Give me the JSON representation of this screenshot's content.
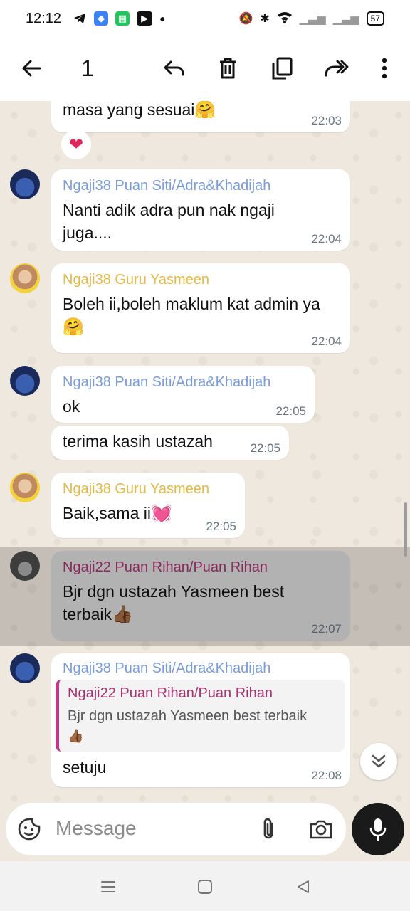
{
  "status_bar": {
    "time": "12:12",
    "battery": "57"
  },
  "action_bar": {
    "selected_count": "1"
  },
  "messages": [
    {
      "text": "masa yang sesuai",
      "emoji": "🤗",
      "time": "22:03"
    },
    {
      "sender": "Ngaji38 Puan Siti/Adra&Khadijah",
      "text": "Nanti adik adra pun nak ngaji juga....",
      "time": "22:04"
    },
    {
      "sender": "Ngaji38 Guru Yasmeen",
      "text": "Boleh ii,boleh maklum kat admin ya",
      "emoji": "🤗",
      "time": "22:04"
    },
    {
      "sender": "Ngaji38 Puan Siti/Adra&Khadijah",
      "text": "ok",
      "time": "22:05"
    },
    {
      "text": "terima kasih ustazah",
      "time": "22:05"
    },
    {
      "sender": "Ngaji38 Guru Yasmeen",
      "text": "Baik,sama ii",
      "emoji": "💓",
      "time": "22:05"
    },
    {
      "sender": "Ngaji22 Puan Rihan/Puan Rihan",
      "text": "Bjr dgn ustazah Yasmeen best terbaik",
      "emoji": "👍🏾",
      "time": "22:07"
    },
    {
      "sender": "Ngaji38 Puan Siti/Adra&Khadijah",
      "quote_sender": "Ngaji22 Puan Rihan/Puan Rihan",
      "quote_text": "Bjr dgn ustazah Yasmeen best terbaik",
      "quote_emoji": "👍🏾",
      "text": "setuju",
      "time": "22:08"
    }
  ],
  "reaction": "❤",
  "input": {
    "placeholder": "Message"
  },
  "colors": {
    "siti": "#7b9cdb",
    "yasmeen": "#e6b845",
    "rihan": "#a8326f"
  }
}
